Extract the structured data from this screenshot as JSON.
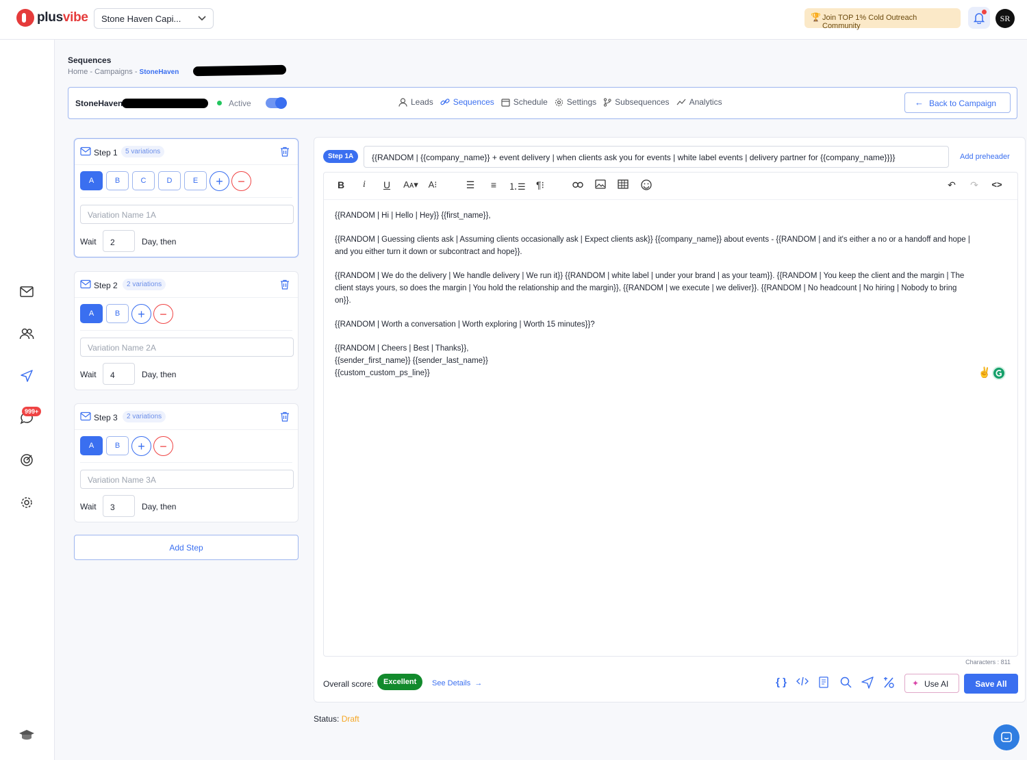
{
  "app": {
    "logo_text_plus": "plus",
    "logo_text_vibe": "vibe",
    "workspace": "Stone Haven Capi...",
    "promo": "Join TOP 1% Cold Outreach Community",
    "avatar": "SR",
    "notif_badge": "999+"
  },
  "page": {
    "title": "Sequences",
    "crumbs": [
      "Home",
      "Campaigns",
      "StoneHaven"
    ]
  },
  "campaign": {
    "name": "StoneHaven",
    "status": "Active",
    "tabs": [
      "Leads",
      "Sequences",
      "Schedule",
      "Settings",
      "Subsequences",
      "Analytics"
    ],
    "back_label": "Back to Campaign"
  },
  "steps": [
    {
      "label": "Step 1",
      "variations": "5 variations",
      "buttons": [
        "A",
        "B",
        "C",
        "D",
        "E"
      ],
      "name_placeholder": "Variation Name 1A",
      "wait": "2",
      "wait_label": "Wait",
      "wait_after": "Day, then"
    },
    {
      "label": "Step 2",
      "variations": "2 variations",
      "buttons": [
        "A",
        "B"
      ],
      "name_placeholder": "Variation Name 2A",
      "wait": "4",
      "wait_label": "Wait",
      "wait_after": "Day, then"
    },
    {
      "label": "Step 3",
      "variations": "2 variations",
      "buttons": [
        "A",
        "B"
      ],
      "name_placeholder": "Variation Name 3A",
      "wait": "3",
      "wait_label": "Wait",
      "wait_after": "Day, then"
    }
  ],
  "add_step": "Add Step",
  "editor": {
    "step_tag": "Step 1A",
    "subject": "{{RANDOM | {{company_name}} + event delivery | when clients ask you for events | white label events | delivery partner for {{company_name}}}}",
    "add_preheader": "Add preheader",
    "body": [
      [
        "{{RANDOM | Hi | Hello | Hey}} {{first_name}},"
      ],
      [
        "{{RANDOM | Guessing clients ask | Assuming clients occasionally ask | Expect clients ask}} {{company_name}} about events - {{RANDOM | and it's either a no or a handoff and hope |",
        "and you either turn it down or subcontract and hope}}."
      ],
      [
        "{{RANDOM | We do the delivery | We handle delivery | We run it}} {{RANDOM | white label | under your brand | as your team}}. {{RANDOM | You keep the client and the margin | The",
        "client stays yours, so does the margin | You hold the relationship and the margin}}, {{RANDOM | we execute | we deliver}}. {{RANDOM | No headcount | No hiring | Nobody to bring",
        "on}}."
      ],
      [
        "{{RANDOM | Worth a conversation | Worth exploring | Worth 15 minutes}}?"
      ],
      [
        "{{RANDOM | Cheers | Best | Thanks}},",
        "{{sender_first_name}} {{sender_last_name}}",
        "{{custom_custom_ps_line}}"
      ]
    ],
    "characters": "Characters : 811",
    "score_label": "Overall score:",
    "score": "Excellent",
    "see_details": "See Details",
    "use_ai": "Use AI",
    "save_all": "Save All"
  },
  "status": {
    "label": "Status:",
    "value": "Draft"
  },
  "colors": {
    "accent": "#3a6ff0",
    "danger": "#ef4444",
    "success": "#128a2c",
    "draft": "#f5a623"
  }
}
